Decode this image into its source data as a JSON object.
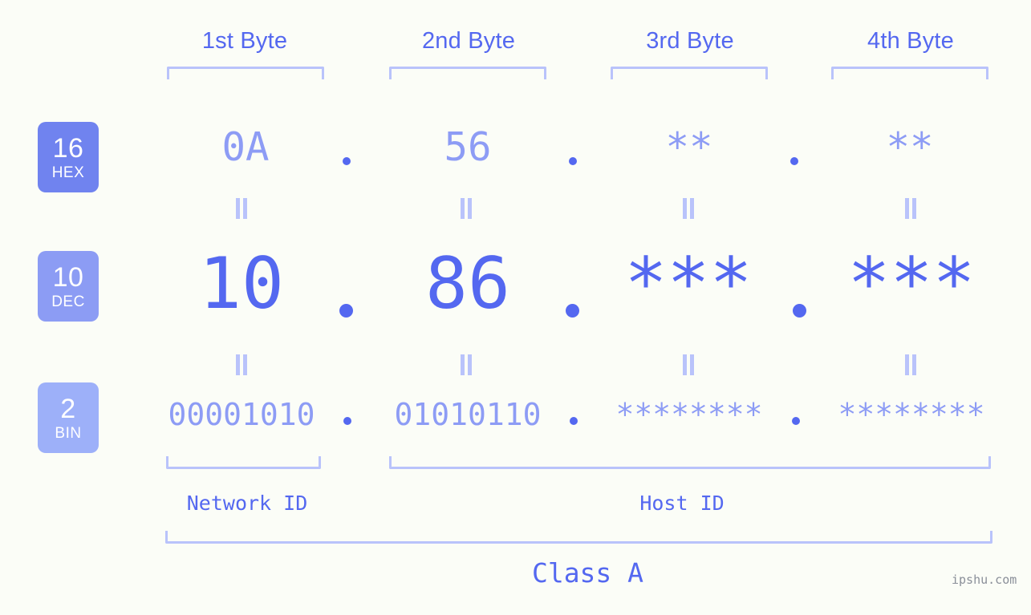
{
  "meta": {
    "watermark": "ipshu.com",
    "address_label": "10.86.*.*",
    "ip_class": "Class A"
  },
  "colors": {
    "background": "#fbfdf7",
    "accent": "#5468f0",
    "mid_blue": "#8d9cf5",
    "light_blue": "#b9c3fb",
    "badge_hex": "#7083ef",
    "badge_dec": "#8c9cf4",
    "badge_bin": "#9db0f9",
    "watermark": "#8a8f99"
  },
  "byte_headers": [
    {
      "label": "1st Byte"
    },
    {
      "label": "2nd Byte"
    },
    {
      "label": "3rd Byte"
    },
    {
      "label": "4th Byte"
    }
  ],
  "rows": [
    {
      "badge_number": "16",
      "badge_name": "HEX",
      "values": [
        "0A",
        "56",
        "**",
        "**"
      ]
    },
    {
      "badge_number": "10",
      "badge_name": "DEC",
      "values": [
        "10",
        "86",
        "***",
        "***"
      ]
    },
    {
      "badge_number": "2",
      "badge_name": "BIN",
      "values": [
        "00001010",
        "01010110",
        "********",
        "********"
      ]
    }
  ],
  "separators": {
    "dot": "."
  },
  "equals_sign": "=",
  "sections": [
    {
      "label": "Network ID"
    },
    {
      "label": "Host ID"
    }
  ],
  "class_bracket": {
    "label": "Class A"
  }
}
